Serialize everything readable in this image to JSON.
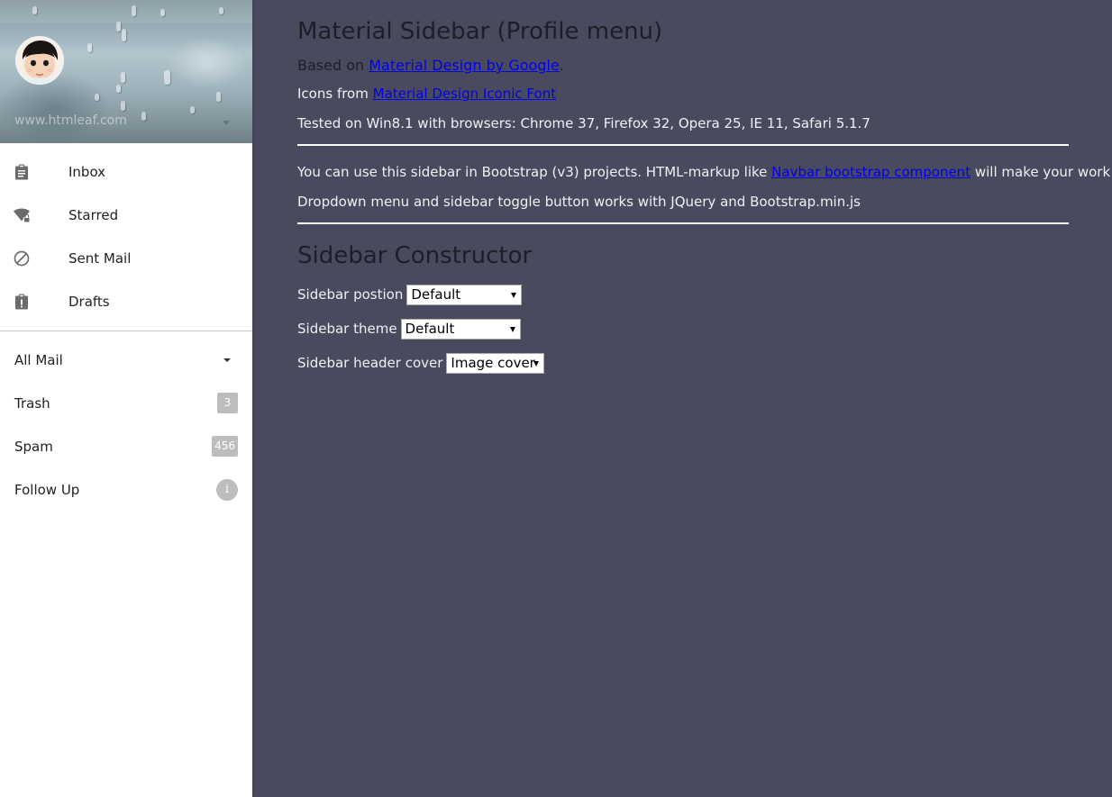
{
  "sidebar": {
    "header": {
      "caption": "www.htmleaf.com",
      "avatar_icon": "avatar-icon",
      "caret_icon": "caret-down-icon"
    },
    "primary_items": [
      {
        "label": "Inbox",
        "icon": "clipboard-icon"
      },
      {
        "label": "Starred",
        "icon": "wifi-lock-icon"
      },
      {
        "label": "Sent Mail",
        "icon": "block-icon"
      },
      {
        "label": "Drafts",
        "icon": "clipboard-alert-icon"
      }
    ],
    "secondary_items": [
      {
        "label": "All Mail",
        "icon": "caret-down-icon"
      },
      {
        "label": "Trash",
        "badge": "3"
      },
      {
        "label": "Spam",
        "badge": "456"
      },
      {
        "label": "Follow Up",
        "badge": "i"
      }
    ]
  },
  "main": {
    "title": "Material Sidebar (Profile menu)",
    "based_on": {
      "prefix": "Based on ",
      "link": "Material Design by Google",
      "suffix": "."
    },
    "icons_from": {
      "prefix": "Icons from ",
      "link": "Material Design Iconic Font"
    },
    "tested": "Tested on Win8.1 with browsers: Chrome 37, Firefox 32, Opera 25, IE 11, Safari 5.1.7",
    "bootstrap_note": {
      "prefix": "You can use this sidebar in Bootstrap (v3) projects. HTML-markup like ",
      "link": "Navbar bootstrap component",
      "suffix": " will make your work easier."
    },
    "dropdown_note": "Dropdown menu and sidebar toggle button works with JQuery and Bootstrap.min.js",
    "constructor_title": "Sidebar Constructor",
    "form": [
      {
        "label": "Sidebar postion",
        "value": "Default"
      },
      {
        "label": "Sidebar theme",
        "value": "Default"
      },
      {
        "label": "Sidebar header cover",
        "value": "Image cover"
      }
    ]
  },
  "colors": {
    "page_background": "#4a4a5e",
    "sidebar_background": "#ffffff",
    "badge": "#bdbdbd",
    "link": "#0000ee"
  }
}
